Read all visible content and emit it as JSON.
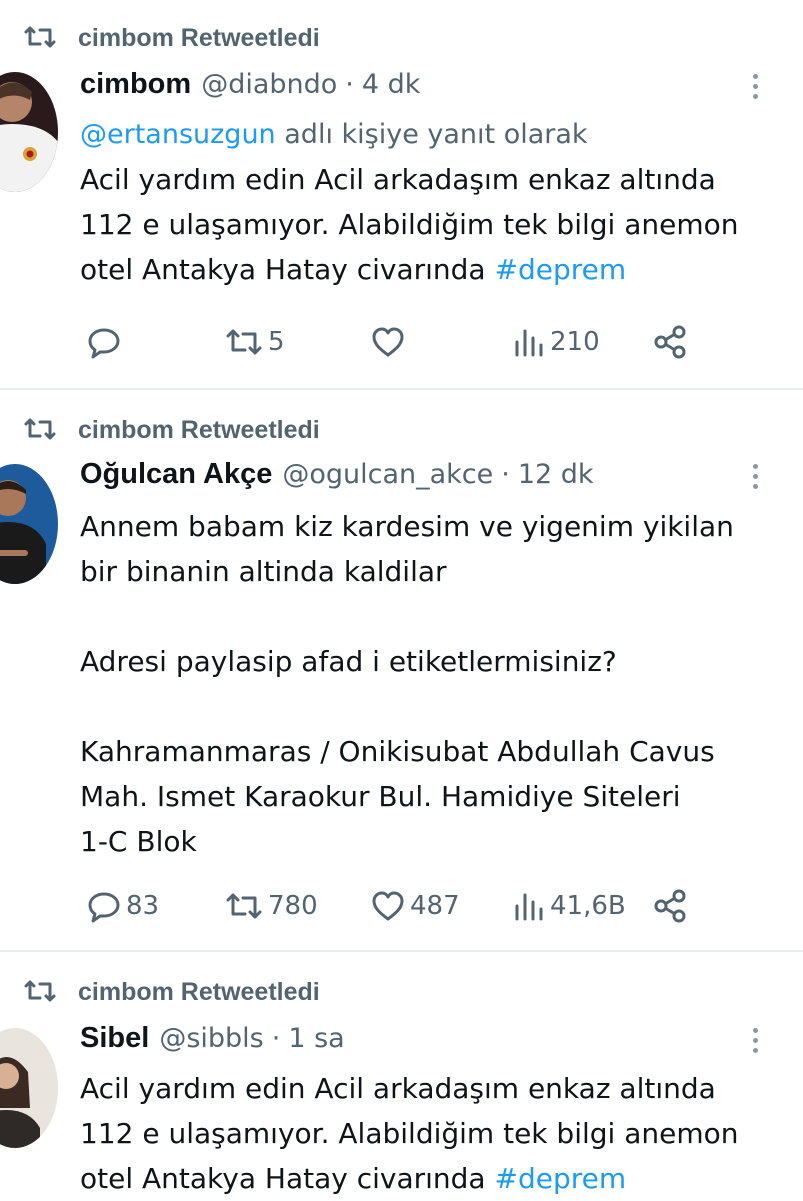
{
  "tweets": [
    {
      "retweeted_by": "cimbom Retweetledi",
      "name": "cimbom",
      "handle": "@diabndo",
      "time": "4 dk",
      "reply_prefix": "@ertansuzgun",
      "reply_suffix": "adlı kişiye yanıt olarak",
      "lines": [
        "Acil yardım edin Acil arkadaşım enkaz altında",
        "112 e ulaşamıyor. Alabildiğim tek bilgi anemon"
      ],
      "last_line": "otel Antakya Hatay civarında",
      "hashtag": "#deprem",
      "replies": "",
      "retweets": "5",
      "likes": "",
      "views": "210"
    },
    {
      "retweeted_by": "cimbom Retweetledi",
      "name": "Oğulcan Akçe",
      "handle": "@ogulcan_akce",
      "time": "12 dk",
      "lines": [
        "Annem babam kiz kardesim ve yigenim yikilan",
        "bir binanin altinda kaldilar",
        "",
        "Adresi paylasip afad i etiketlermisiniz?",
        "",
        "Kahramanmaras / Onikisubat Abdullah Cavus",
        "Mah. Ismet Karaokur Bul. Hamidiye Siteleri",
        "1-C Blok"
      ],
      "replies": "83",
      "retweets": "780",
      "likes": "487",
      "views": "41,6B"
    },
    {
      "retweeted_by": "cimbom Retweetledi",
      "name": "Sibel",
      "handle": "@sibbls",
      "time": "1 sa",
      "lines": [
        "Acil yardım edin Acil arkadaşım enkaz altında",
        "112 e ulaşamıyor. Alabildiğim tek bilgi anemon"
      ],
      "last_line": "otel Antakya Hatay civarında",
      "hashtag": "#deprem"
    }
  ],
  "icons": {
    "retweet": "retweet-icon",
    "reply": "reply-icon",
    "like": "heart-icon",
    "views": "views-icon",
    "share": "share-icon",
    "more": "more-icon"
  },
  "colors": {
    "link": "#1d9bf0",
    "muted": "#536471",
    "text": "#0f1419"
  }
}
